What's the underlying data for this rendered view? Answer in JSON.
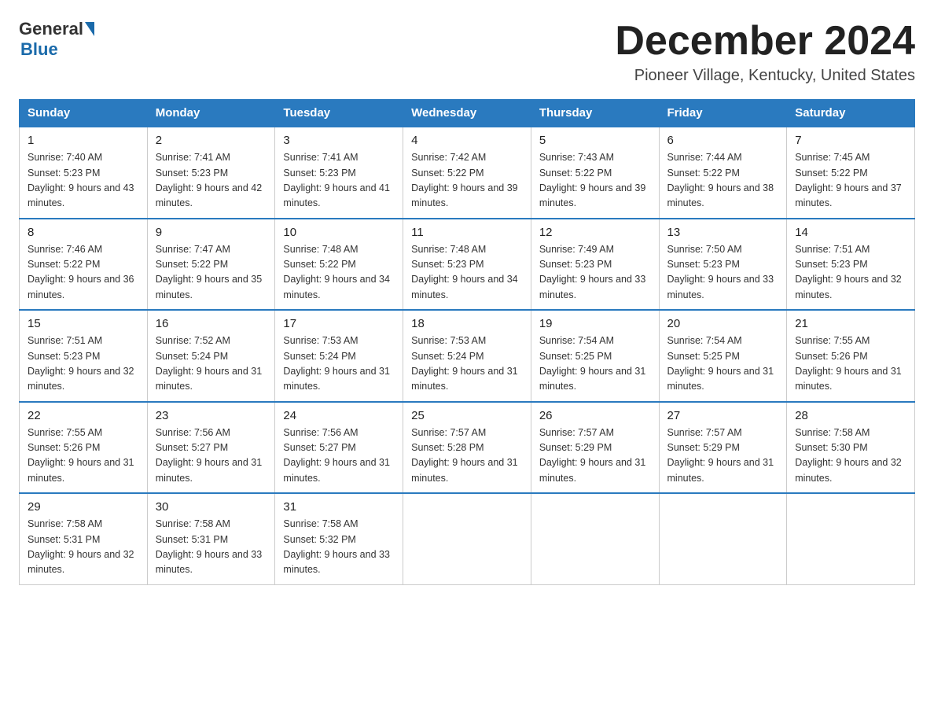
{
  "logo": {
    "general": "General",
    "blue": "Blue"
  },
  "title": "December 2024",
  "subtitle": "Pioneer Village, Kentucky, United States",
  "days_of_week": [
    "Sunday",
    "Monday",
    "Tuesday",
    "Wednesday",
    "Thursday",
    "Friday",
    "Saturday"
  ],
  "weeks": [
    [
      {
        "day": 1,
        "sunrise": "7:40 AM",
        "sunset": "5:23 PM",
        "daylight": "9 hours and 43 minutes."
      },
      {
        "day": 2,
        "sunrise": "7:41 AM",
        "sunset": "5:23 PM",
        "daylight": "9 hours and 42 minutes."
      },
      {
        "day": 3,
        "sunrise": "7:41 AM",
        "sunset": "5:23 PM",
        "daylight": "9 hours and 41 minutes."
      },
      {
        "day": 4,
        "sunrise": "7:42 AM",
        "sunset": "5:22 PM",
        "daylight": "9 hours and 39 minutes."
      },
      {
        "day": 5,
        "sunrise": "7:43 AM",
        "sunset": "5:22 PM",
        "daylight": "9 hours and 39 minutes."
      },
      {
        "day": 6,
        "sunrise": "7:44 AM",
        "sunset": "5:22 PM",
        "daylight": "9 hours and 38 minutes."
      },
      {
        "day": 7,
        "sunrise": "7:45 AM",
        "sunset": "5:22 PM",
        "daylight": "9 hours and 37 minutes."
      }
    ],
    [
      {
        "day": 8,
        "sunrise": "7:46 AM",
        "sunset": "5:22 PM",
        "daylight": "9 hours and 36 minutes."
      },
      {
        "day": 9,
        "sunrise": "7:47 AM",
        "sunset": "5:22 PM",
        "daylight": "9 hours and 35 minutes."
      },
      {
        "day": 10,
        "sunrise": "7:48 AM",
        "sunset": "5:22 PM",
        "daylight": "9 hours and 34 minutes."
      },
      {
        "day": 11,
        "sunrise": "7:48 AM",
        "sunset": "5:23 PM",
        "daylight": "9 hours and 34 minutes."
      },
      {
        "day": 12,
        "sunrise": "7:49 AM",
        "sunset": "5:23 PM",
        "daylight": "9 hours and 33 minutes."
      },
      {
        "day": 13,
        "sunrise": "7:50 AM",
        "sunset": "5:23 PM",
        "daylight": "9 hours and 33 minutes."
      },
      {
        "day": 14,
        "sunrise": "7:51 AM",
        "sunset": "5:23 PM",
        "daylight": "9 hours and 32 minutes."
      }
    ],
    [
      {
        "day": 15,
        "sunrise": "7:51 AM",
        "sunset": "5:23 PM",
        "daylight": "9 hours and 32 minutes."
      },
      {
        "day": 16,
        "sunrise": "7:52 AM",
        "sunset": "5:24 PM",
        "daylight": "9 hours and 31 minutes."
      },
      {
        "day": 17,
        "sunrise": "7:53 AM",
        "sunset": "5:24 PM",
        "daylight": "9 hours and 31 minutes."
      },
      {
        "day": 18,
        "sunrise": "7:53 AM",
        "sunset": "5:24 PM",
        "daylight": "9 hours and 31 minutes."
      },
      {
        "day": 19,
        "sunrise": "7:54 AM",
        "sunset": "5:25 PM",
        "daylight": "9 hours and 31 minutes."
      },
      {
        "day": 20,
        "sunrise": "7:54 AM",
        "sunset": "5:25 PM",
        "daylight": "9 hours and 31 minutes."
      },
      {
        "day": 21,
        "sunrise": "7:55 AM",
        "sunset": "5:26 PM",
        "daylight": "9 hours and 31 minutes."
      }
    ],
    [
      {
        "day": 22,
        "sunrise": "7:55 AM",
        "sunset": "5:26 PM",
        "daylight": "9 hours and 31 minutes."
      },
      {
        "day": 23,
        "sunrise": "7:56 AM",
        "sunset": "5:27 PM",
        "daylight": "9 hours and 31 minutes."
      },
      {
        "day": 24,
        "sunrise": "7:56 AM",
        "sunset": "5:27 PM",
        "daylight": "9 hours and 31 minutes."
      },
      {
        "day": 25,
        "sunrise": "7:57 AM",
        "sunset": "5:28 PM",
        "daylight": "9 hours and 31 minutes."
      },
      {
        "day": 26,
        "sunrise": "7:57 AM",
        "sunset": "5:29 PM",
        "daylight": "9 hours and 31 minutes."
      },
      {
        "day": 27,
        "sunrise": "7:57 AM",
        "sunset": "5:29 PM",
        "daylight": "9 hours and 31 minutes."
      },
      {
        "day": 28,
        "sunrise": "7:58 AM",
        "sunset": "5:30 PM",
        "daylight": "9 hours and 32 minutes."
      }
    ],
    [
      {
        "day": 29,
        "sunrise": "7:58 AM",
        "sunset": "5:31 PM",
        "daylight": "9 hours and 32 minutes."
      },
      {
        "day": 30,
        "sunrise": "7:58 AM",
        "sunset": "5:31 PM",
        "daylight": "9 hours and 33 minutes."
      },
      {
        "day": 31,
        "sunrise": "7:58 AM",
        "sunset": "5:32 PM",
        "daylight": "9 hours and 33 minutes."
      },
      null,
      null,
      null,
      null
    ]
  ]
}
